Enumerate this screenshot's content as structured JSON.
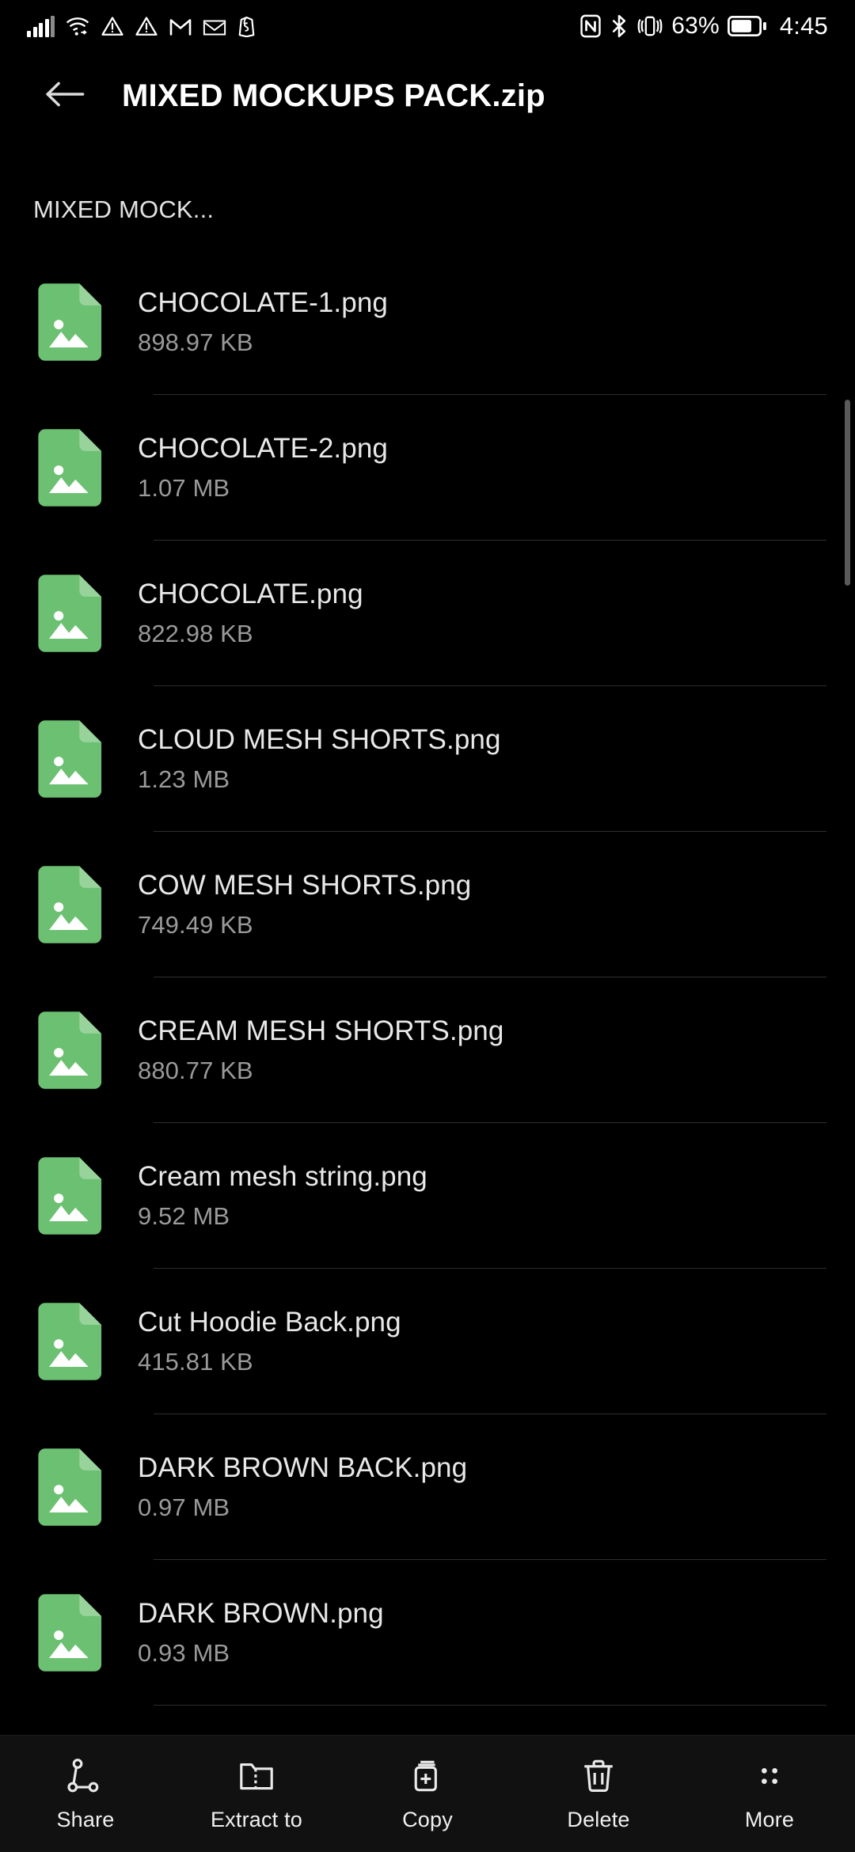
{
  "status_bar": {
    "left_icons": [
      "signal-icon",
      "wifi-icon",
      "warning-icon",
      "warning-icon",
      "gmail-icon",
      "mail-icon",
      "shopify-icon"
    ],
    "right_icons": [
      "nfc-icon",
      "bluetooth-icon",
      "vibrate-icon",
      "battery-icon"
    ],
    "battery_percent": "63%",
    "time": "4:45"
  },
  "app_bar": {
    "back_icon": "back-arrow-icon",
    "title": "MIXED MOCKUPS PACK.zip"
  },
  "breadcrumb": {
    "text": "MIXED MOCK..."
  },
  "colors": {
    "background": "#000000",
    "file_icon_green": "#6cc071",
    "file_name": "#e8e8e8",
    "file_size": "#9a9a9a",
    "divider": "#2e2e2e",
    "bottom_bar": "#111111"
  },
  "file_list": {
    "icon_name": "image-file-icon",
    "items": [
      {
        "name": "CHOCOLATE-1.png",
        "size": "898.97 KB"
      },
      {
        "name": "CHOCOLATE-2.png",
        "size": "1.07 MB"
      },
      {
        "name": "CHOCOLATE.png",
        "size": "822.98 KB"
      },
      {
        "name": "CLOUD MESH SHORTS.png",
        "size": "1.23 MB"
      },
      {
        "name": "COW MESH SHORTS.png",
        "size": "749.49 KB"
      },
      {
        "name": "CREAM MESH SHORTS.png",
        "size": "880.77 KB"
      },
      {
        "name": "Cream mesh string.png",
        "size": "9.52 MB"
      },
      {
        "name": "Cut Hoodie Back.png",
        "size": "415.81 KB"
      },
      {
        "name": "DARK BROWN BACK.png",
        "size": "0.97 MB"
      },
      {
        "name": "DARK BROWN.png",
        "size": "0.93 MB"
      }
    ]
  },
  "bottom_bar": {
    "items": [
      {
        "label": "Share",
        "icon": "share-icon"
      },
      {
        "label": "Extract to",
        "icon": "extract-folder-icon"
      },
      {
        "label": "Copy",
        "icon": "copy-icon"
      },
      {
        "label": "Delete",
        "icon": "trash-icon"
      },
      {
        "label": "More",
        "icon": "more-dots-icon"
      }
    ]
  }
}
